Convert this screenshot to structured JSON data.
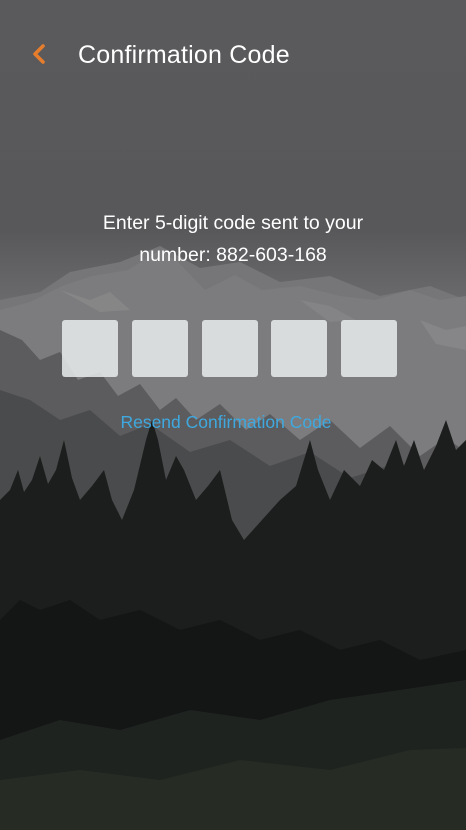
{
  "header": {
    "title": "Confirmation Code",
    "back_icon": "chevron-left-icon",
    "accent_color": "#e57d2d"
  },
  "instructions": {
    "line1": "Enter 5-digit code sent to your",
    "line2": "number: 882-603-168"
  },
  "code_inputs": [
    "",
    "",
    "",
    "",
    ""
  ],
  "resend": {
    "label": "Resend Confirmation Code",
    "color": "#3fa9df"
  },
  "background": {
    "description_icon": "mountain-forest-background"
  }
}
